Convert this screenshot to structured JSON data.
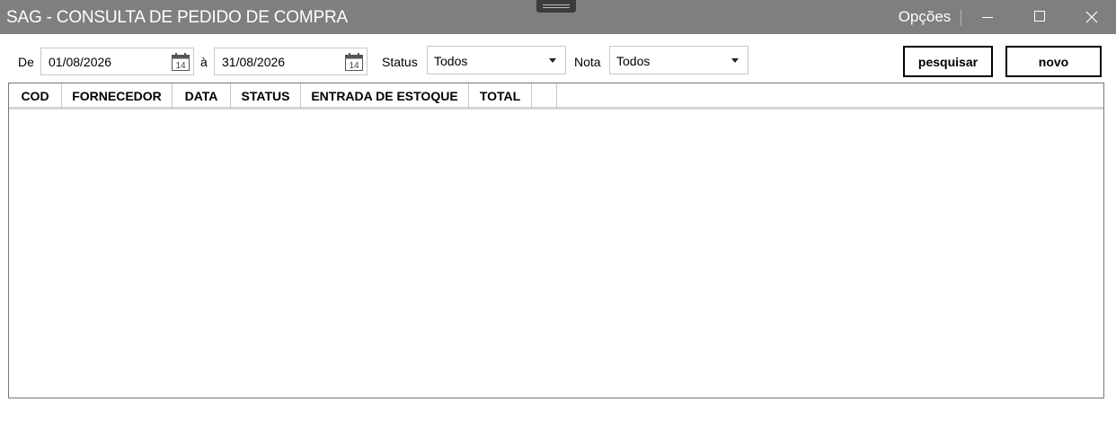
{
  "window": {
    "title": "SAG - CONSULTA DE PEDIDO DE COMPRA",
    "options_label": "Opções"
  },
  "filters": {
    "from_label": "De",
    "from_date": "01/08/2026",
    "to_label": "à",
    "to_date": "31/08/2026",
    "calendar_day": "14",
    "status_label": "Status",
    "status_value": "Todos",
    "nota_label": "Nota",
    "nota_value": "Todos"
  },
  "actions": {
    "search_label": "pesquisar",
    "new_label": "novo"
  },
  "grid": {
    "columns": [
      "COD",
      "FORNECEDOR",
      "DATA",
      "STATUS",
      "ENTRADA DE ESTOQUE",
      "TOTAL",
      ""
    ],
    "rows": []
  }
}
